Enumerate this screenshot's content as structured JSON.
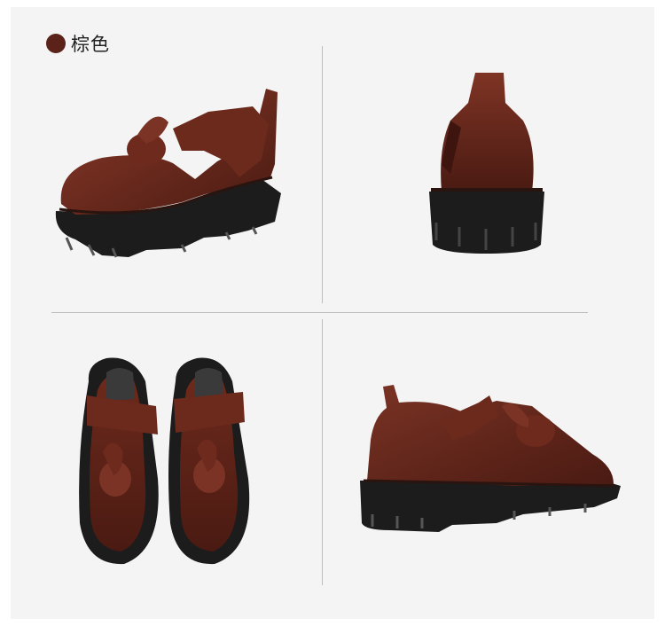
{
  "color_option": {
    "label": "棕色",
    "swatch_hex": "#5a2218"
  },
  "colors": {
    "leather": "#5b2118",
    "leather_light": "#7a3324",
    "sole": "#1c1c1c",
    "background": "#f4f4f4"
  },
  "views": [
    {
      "name": "side-view-left"
    },
    {
      "name": "back-view"
    },
    {
      "name": "top-view-pair"
    },
    {
      "name": "side-view-right"
    }
  ]
}
